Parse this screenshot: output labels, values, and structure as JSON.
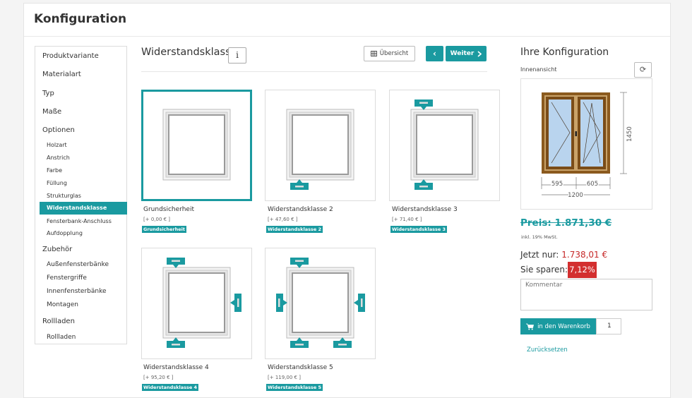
{
  "header": {
    "title": "Konfiguration"
  },
  "nav": {
    "items": [
      {
        "label": "Produktvariante"
      },
      {
        "label": "Materialart"
      },
      {
        "label": "Typ"
      },
      {
        "label": "Maße"
      },
      {
        "label": "Optionen"
      },
      {
        "label": "Zubehör"
      },
      {
        "label": "Rollladen"
      }
    ],
    "optionen_sub": [
      {
        "label": "Holzart"
      },
      {
        "label": "Anstrich"
      },
      {
        "label": "Farbe"
      },
      {
        "label": "Füllung"
      },
      {
        "label": "Strukturglas"
      },
      {
        "label": "Widerstandsklasse",
        "active": true
      },
      {
        "label": "Fensterbank-Anschluss"
      },
      {
        "label": "Aufdopplung"
      }
    ],
    "zubehoer_sub": [
      {
        "label": "Außenfensterbänke"
      },
      {
        "label": "Fenstergriffe"
      },
      {
        "label": "Innenfensterbänke"
      },
      {
        "label": "Montagen"
      }
    ],
    "rollladen_sub": [
      {
        "label": "Rollladen"
      }
    ]
  },
  "step": {
    "title": "Widerstandsklasse",
    "info_icon": "i",
    "overview_label": "Übersicht",
    "prev_icon": "‹",
    "next_label": "Weiter"
  },
  "options": [
    {
      "name": "Grundsicherheit",
      "price": "[+ 0,00 € ]",
      "badge": "Grundsicherheit",
      "selected": true
    },
    {
      "name": "Widerstandsklasse 2",
      "price": "[+ 47,60 € ]",
      "badge": "Widerstandsklasse 2",
      "selected": false
    },
    {
      "name": "Widerstandsklasse 3",
      "price": "[+ 71,40 € ]",
      "badge": "Widerstandsklasse 3",
      "selected": false
    },
    {
      "name": "Widerstandsklasse 4",
      "price": "[+ 95,20 € ]",
      "badge": "Widerstandsklasse 4",
      "selected": false
    },
    {
      "name": "Widerstandsklasse 5",
      "price": "[+ 119,00 € ]",
      "badge": "Widerstandsklasse 5",
      "selected": false
    }
  ],
  "config": {
    "title": "Ihre Konfiguration",
    "view_label": "Innenansicht",
    "dim_height": "1450",
    "dim_left": "595",
    "dim_right": "605",
    "dim_total": "1200",
    "price_old": "Preis: 1.871,30 €",
    "price_note": "inkl. 19% MwSt.",
    "now_label": "Jetzt nur: ",
    "now_value": "1.738,01 €",
    "save_label": "Sie sparen:",
    "save_value": "7,12%",
    "comment_placeholder": "Kommentar",
    "cart_label": "in den Warenkorb",
    "qty": "1",
    "reset_label": "Zurücksetzen"
  },
  "colors": {
    "accent": "#1a9aa0",
    "price_red": "#c62828",
    "save_badge": "#d32f2f",
    "frame_wood": "#8b5a1e"
  }
}
